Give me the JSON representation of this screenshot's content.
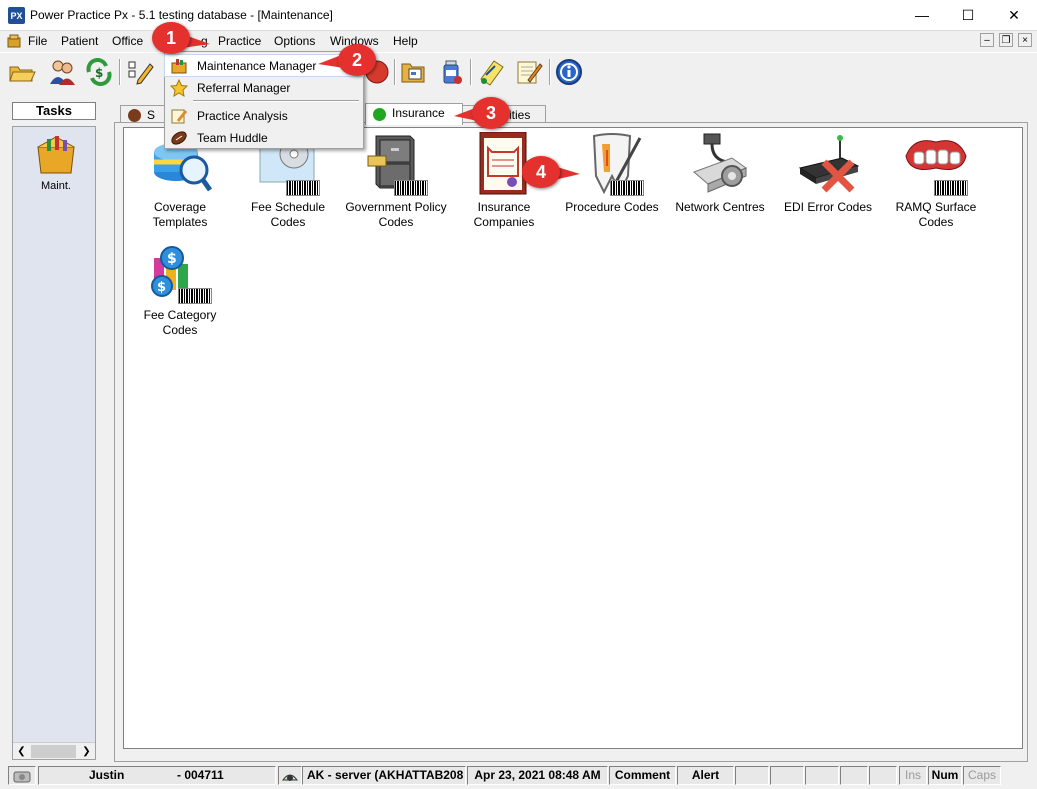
{
  "window": {
    "title": "Power Practice Px - 5.1 testing database - [Maintenance]",
    "app_icon_text": "PX"
  },
  "menubar": {
    "items": [
      "File",
      "Patient",
      "Office",
      "Practice",
      "Options",
      "Windows",
      "Help"
    ],
    "hidden_item": "g"
  },
  "dropdown": {
    "items": [
      "Maintenance Manager",
      "Referral Manager",
      "Practice Analysis",
      "Team Huddle"
    ]
  },
  "tasks": {
    "title": "Tasks",
    "item_label": "Maint."
  },
  "tabs": {
    "first": "S",
    "insurance": "Insurance",
    "last": "ities"
  },
  "icons": [
    {
      "label": "Coverage Templates",
      "icon": "coverage-icon"
    },
    {
      "label": "Fee Schedule Codes",
      "icon": "fee-schedule-icon"
    },
    {
      "label": "Government Policy Codes",
      "icon": "government-policy-icon"
    },
    {
      "label": "Insurance Companies",
      "icon": "insurance-companies-icon"
    },
    {
      "label": "Procedure Codes",
      "icon": "procedure-codes-icon"
    },
    {
      "label": "Network Centres",
      "icon": "network-centres-icon"
    },
    {
      "label": "EDI Error Codes",
      "icon": "edi-error-icon"
    },
    {
      "label": "RAMQ Surface Codes",
      "icon": "ramq-surface-icon"
    },
    {
      "label": "Fee Category Codes",
      "icon": "fee-category-icon"
    }
  ],
  "callouts": [
    "1",
    "2",
    "3",
    "4"
  ],
  "statusbar": {
    "user": "Justin",
    "user_id": "- 004711",
    "server": "AK - server (AKHATTAB208",
    "datetime": "Apr 23, 2021 08:48 AM",
    "comment": "Comment",
    "alert": "Alert",
    "ins": "Ins",
    "num": "Num",
    "caps": "Caps"
  },
  "colors": {
    "callout": "#e5312e",
    "insurance_dot": "#1fa81f",
    "first_tab_dot": "#7a3b1c"
  }
}
